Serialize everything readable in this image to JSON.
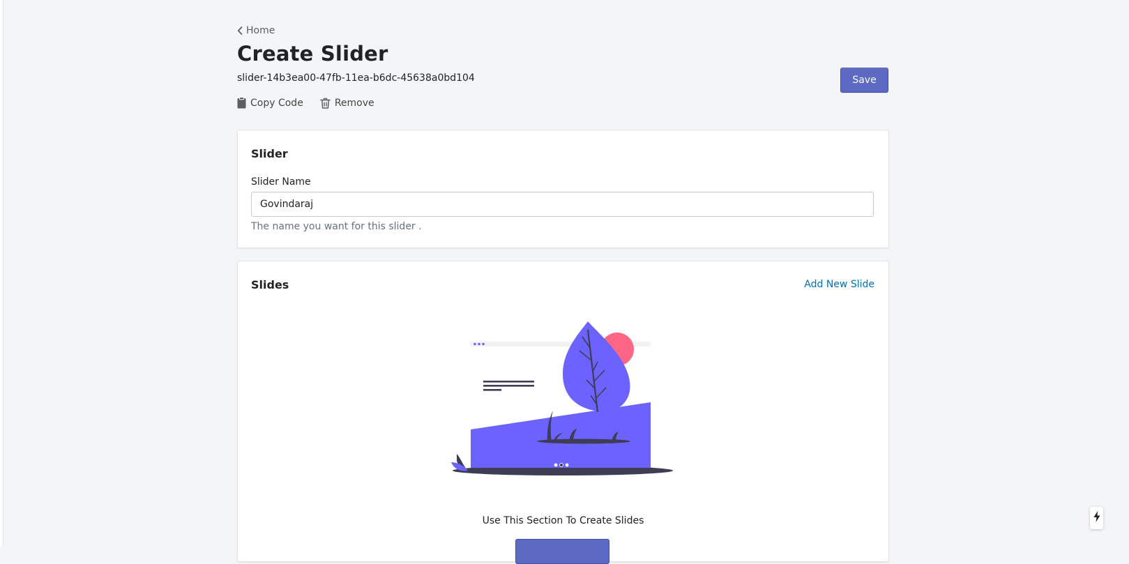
{
  "breadcrumb": {
    "label": "Home",
    "icon": "chevron-left-icon"
  },
  "page": {
    "title": "Create Slider",
    "slider_id": "slider-14b3ea00-47fb-11ea-b6dc-45638a0bd104",
    "save_label": "Save"
  },
  "actions": {
    "copy_code": {
      "label": "Copy Code",
      "icon": "clipboard-icon"
    },
    "remove": {
      "label": "Remove",
      "icon": "trash-icon"
    }
  },
  "slider_card": {
    "title": "Slider",
    "name_label": "Slider Name",
    "name_value": "Govindaraj",
    "name_help": "The name you want for this slider ."
  },
  "slides_card": {
    "title": "Slides",
    "add_link": "Add New Slide",
    "empty_text": "Use This Section To Create Slides",
    "illustration": "empty-slides-illustration"
  },
  "colors": {
    "primary": "#5c6ac4",
    "link": "#006fbb",
    "illustration_purple": "#6c63ff",
    "illustration_pink": "#ff6584",
    "illustration_dark": "#3f3d56",
    "background": "#f4f5f7"
  },
  "fab": {
    "icon": "lightning-bolt-icon"
  }
}
